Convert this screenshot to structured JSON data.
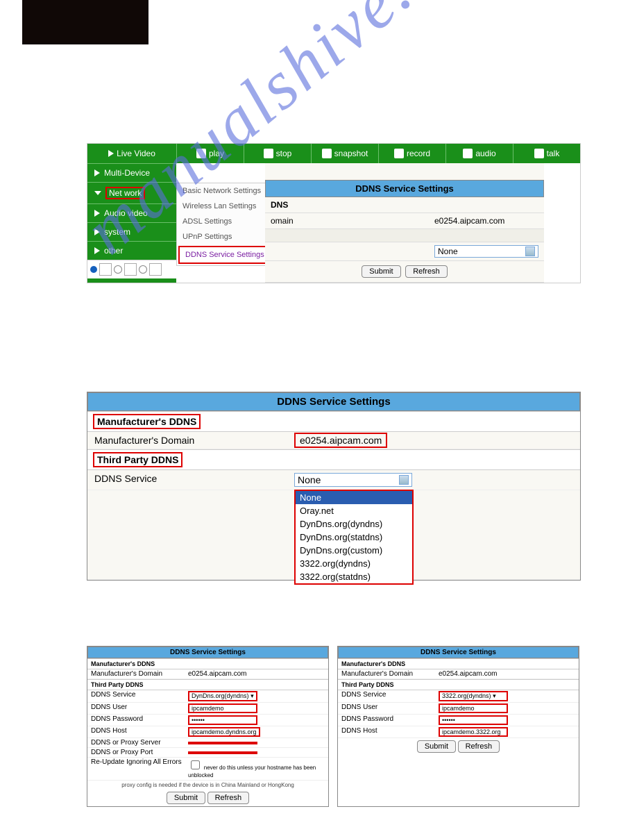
{
  "watermark": "manualshive.com",
  "fig1": {
    "topbar": {
      "live": "Live Video",
      "play": "play",
      "stop": "stop",
      "snapshot": "snapshot",
      "record": "record",
      "audio": "audio",
      "talk": "talk"
    },
    "side": [
      "Multi-Device",
      "Net work",
      "Audio video",
      "system",
      "other"
    ],
    "flyout": [
      "Basic Network Settings",
      "Wireless Lan Settings",
      "ADSL Settings",
      "UPnP Settings",
      "DDNS Service Settings"
    ],
    "title": "DDNS Service Settings",
    "r1": "DNS",
    "r2_l": "omain",
    "r2_r": "e0254.aipcam.com",
    "ddns_none": "None",
    "submit": "Submit",
    "refresh": "Refresh"
  },
  "fig2": {
    "title": "DDNS Service Settings",
    "mfr": "Manufacturer's DDNS",
    "mfr_dom_l": "Manufacturer's Domain",
    "mfr_dom_v": "e0254.aipcam.com",
    "tp": "Third Party DDNS",
    "svc_l": "DDNS Service",
    "svc_v": "None",
    "opts": [
      "None",
      "Oray.net",
      "DynDns.org(dyndns)",
      "DynDns.org(statdns)",
      "DynDns.org(custom)",
      "3322.org(dyndns)",
      "3322.org(statdns)"
    ]
  },
  "fig3": {
    "title": "DDNS Service Settings",
    "mfr": "Manufacturer's DDNS",
    "mfr_dom_l": "Manufacturer's Domain",
    "mfr_dom_v": "e0254.aipcam.com",
    "tp": "Third Party DDNS",
    "left": {
      "svc": "DynDns.org(dyndns)",
      "user": "ipcamdemo",
      "pwd": "••••••",
      "host": "ipcamdemo.dyndns.org",
      "proxy_srv": "",
      "proxy_port": "",
      "reupdate": "Re-Update Ignoring All Errors",
      "reupdate_note": "never do this unless your hostname has been unblocked",
      "proxy_note": "proxy config is needed if the device is in China Mainland or HongKong"
    },
    "right": {
      "svc": "3322.org(dyndns)",
      "user": "ipcamdemo",
      "pwd": "••••••",
      "host": "ipcamdemo.3322.org"
    },
    "labels": {
      "svc": "DDNS Service",
      "user": "DDNS User",
      "pwd": "DDNS Password",
      "host": "DDNS Host",
      "proxy_srv": "DDNS or Proxy Server",
      "proxy_port": "DDNS or Proxy Port"
    },
    "submit": "Submit",
    "refresh": "Refresh"
  }
}
